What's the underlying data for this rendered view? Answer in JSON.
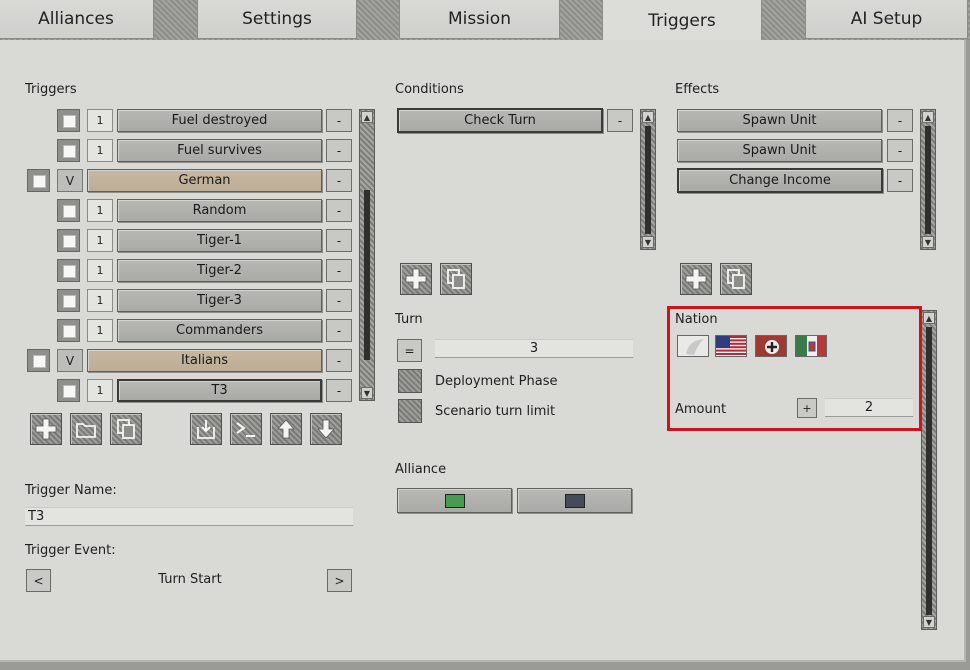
{
  "tabs": [
    {
      "label": "Alliances"
    },
    {
      "label": "Settings"
    },
    {
      "label": "Mission"
    },
    {
      "label": "Triggers"
    },
    {
      "label": "AI Setup"
    }
  ],
  "triggers": {
    "header": "Triggers",
    "items": [
      {
        "flag": "1",
        "label": "Fuel destroyed"
      },
      {
        "flag": "1",
        "label": "Fuel survives"
      },
      {
        "flag": "V",
        "label": "German",
        "group": true
      },
      {
        "flag": "1",
        "label": "Random"
      },
      {
        "flag": "1",
        "label": "Tiger-1"
      },
      {
        "flag": "1",
        "label": "Tiger-2"
      },
      {
        "flag": "1",
        "label": "Tiger-3"
      },
      {
        "flag": "1",
        "label": "Commanders"
      },
      {
        "flag": "V",
        "label": "Italians",
        "group": true
      },
      {
        "flag": "1",
        "label": "T3",
        "selected": true
      }
    ],
    "remove_label": "-"
  },
  "trigger_name": {
    "label": "Trigger Name:",
    "value": "T3"
  },
  "trigger_event": {
    "label": "Trigger Event:",
    "value": "Turn Start",
    "prev": "<",
    "next": ">"
  },
  "conditions": {
    "header": "Conditions",
    "items": [
      {
        "label": "Check Turn"
      }
    ],
    "remove_label": "-"
  },
  "turn": {
    "header": "Turn",
    "operator": "=",
    "value": "3",
    "deployment_phase": "Deployment Phase",
    "scenario_turn_limit": "Scenario turn limit"
  },
  "alliance": {
    "header": "Alliance",
    "colors": [
      "#4a9a4f",
      "#474b57"
    ]
  },
  "effects": {
    "header": "Effects",
    "items": [
      {
        "label": "Spawn Unit"
      },
      {
        "label": "Spawn Unit"
      },
      {
        "label": "Change Income"
      }
    ],
    "remove_label": "-"
  },
  "nation": {
    "header": "Nation",
    "flags": [
      "neutral-flag-icon",
      "usa-flag-icon",
      "german-flag-icon",
      "italian-flag-icon"
    ]
  },
  "amount": {
    "label": "Amount",
    "operator": "+",
    "value": "2"
  },
  "icons": {
    "add": "plus-icon",
    "folder": "folder-icon",
    "copy": "copy-icon",
    "import": "import-icon",
    "console": "console-icon",
    "up": "arrow-up-icon",
    "down": "arrow-down-icon"
  },
  "colors": {
    "highlight": "#d0121b",
    "group_row": "#c2b29b"
  }
}
